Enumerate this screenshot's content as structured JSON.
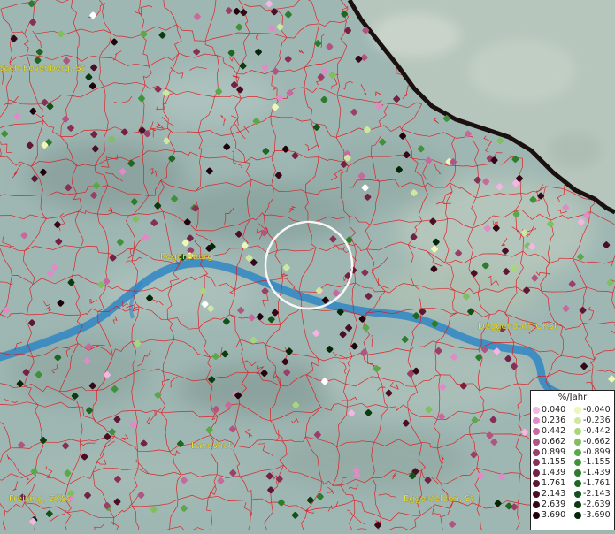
{
  "map": {
    "cities": [
      {
        "name": "bach-Rosenberg, St"
      },
      {
        "name": "Regensburg"
      },
      {
        "name": "Deggendorf, GKSt"
      },
      {
        "name": "Landshut"
      },
      {
        "name": "Freising, GKSt"
      },
      {
        "name": "Eggenfelden, St"
      }
    ],
    "colors": {
      "terrain": "#9fb7b3",
      "river": "#2f86c4",
      "boundary": "#e0151b",
      "border": "#1a1010",
      "label": "#e8e23a"
    }
  },
  "legend": {
    "title": "%/Jahr",
    "positive": [
      {
        "label": "0.040",
        "color": "#f2b6e2"
      },
      {
        "label": "0.236",
        "color": "#e08ac8"
      },
      {
        "label": "0.442",
        "color": "#c8689e"
      },
      {
        "label": "0.662",
        "color": "#b05482"
      },
      {
        "label": "0.899",
        "color": "#9a3f68"
      },
      {
        "label": "1.155",
        "color": "#872f55"
      },
      {
        "label": "1.439",
        "color": "#732244"
      },
      {
        "label": "1.761",
        "color": "#5e1833"
      },
      {
        "label": "2.143",
        "color": "#4a0f25"
      },
      {
        "label": "2.639",
        "color": "#350818"
      },
      {
        "label": "3.690",
        "color": "#1e030b"
      }
    ],
    "negative": [
      {
        "label": "-0.040",
        "color": "#eef7b6"
      },
      {
        "label": "-0.236",
        "color": "#cfe8a0"
      },
      {
        "label": "-0.442",
        "color": "#a9d67c"
      },
      {
        "label": "-0.662",
        "color": "#7fbf5e"
      },
      {
        "label": "-0.899",
        "color": "#5aa849"
      },
      {
        "label": "-1.155",
        "color": "#3e9238"
      },
      {
        "label": "-1.439",
        "color": "#2b7c2b"
      },
      {
        "label": "-1.761",
        "color": "#1f6622"
      },
      {
        "label": "-2.143",
        "color": "#13511a"
      },
      {
        "label": "-2.639",
        "color": "#0a3c10"
      },
      {
        "label": "-3.690",
        "color": "#032606"
      }
    ]
  }
}
